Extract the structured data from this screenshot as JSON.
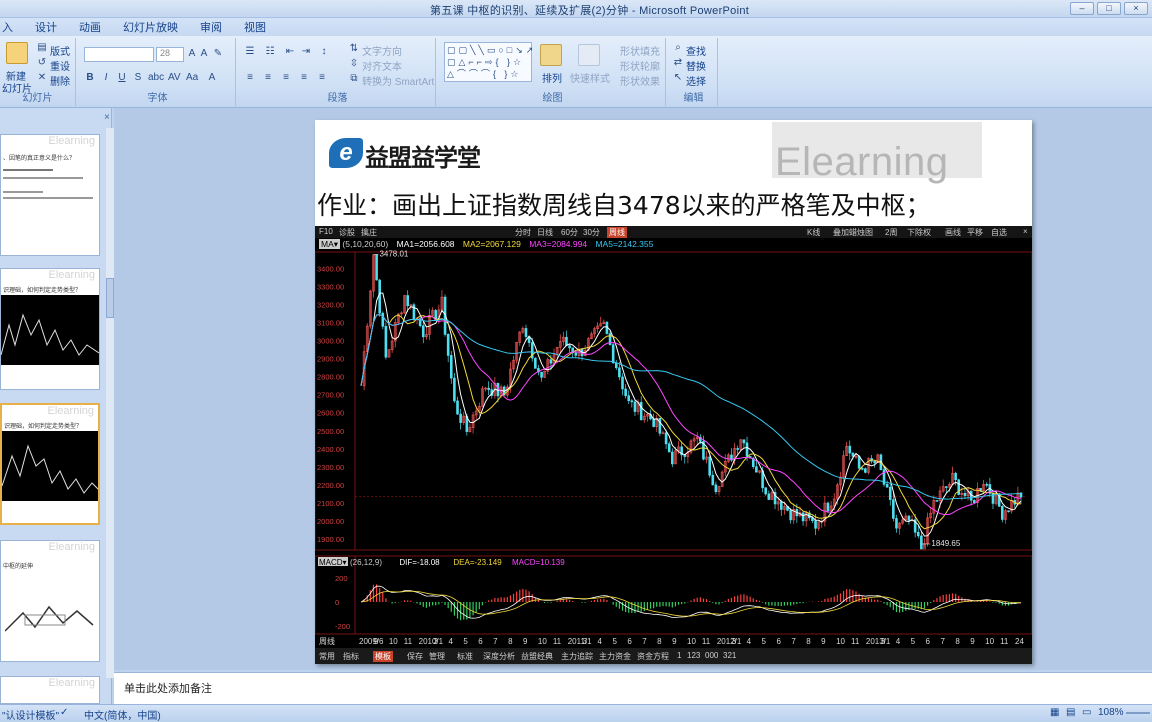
{
  "window": {
    "title": "第五课 中枢的识别、延续及扩展(2)分钟 - Microsoft PowerPoint"
  },
  "ribbon_tabs": [
    "入",
    "设计",
    "动画",
    "幻灯片放映",
    "审阅",
    "视图"
  ],
  "ribbon": {
    "slides_group": {
      "new_slide": "新建",
      "new_slide2": "幻灯片",
      "layout": "版式",
      "reset": "重设",
      "delete": "删除",
      "label": "幻灯片"
    },
    "font_group": {
      "font_size": "28",
      "label": "字体"
    },
    "paragraph_group": {
      "text_direction": "文字方向",
      "align_text": "对齐文本",
      "smartart": "转换为 SmartArt",
      "label": "段落"
    },
    "drawing_group": {
      "arrange": "排列",
      "quick_styles": "快速样式",
      "shape_fill": "形状填充",
      "shape_outline": "形状轮廓",
      "shape_effects": "形状效果",
      "label": "绘图"
    },
    "editing_group": {
      "find": "查找",
      "replace": "替换",
      "select": "选择",
      "label": "编辑"
    }
  },
  "thumbnails": [
    {
      "banner": "Elearning",
      "line1": "、因笔的真正意义是什么？",
      "line2": "",
      "line3": "",
      "line4": ""
    },
    {
      "banner": "Elearning",
      "line1": "识理础，如何判定走势类型？",
      "line2": "",
      "line3": "",
      "line4": ""
    },
    {
      "banner": "Elearning",
      "line1": "识理础，如何判定走势类型？",
      "line2": "",
      "line3": "",
      "line4": ""
    },
    {
      "banner": "Elearning",
      "line1": "中枢的延伸",
      "line2": "",
      "line3": "",
      "line4": ""
    },
    {
      "banner": "Elearning",
      "line1": "",
      "line2": "",
      "line3": "",
      "line4": ""
    }
  ],
  "slide": {
    "brand_watermark": "Elearning",
    "logo_name": "益盟益学堂",
    "logo_mark": "e",
    "homework": "作业：画出上证指数周线自3478以来的严格笔及中枢；"
  },
  "stock": {
    "toolbar": {
      "f10": "F10",
      "diag": "诊股",
      "tag": "擒庄",
      "fenshi": "分时",
      "day": "日线",
      "m60": "60分",
      "m30": "30分",
      "week": "周线",
      "kline": "K线",
      "overlay": "叠加蜡烛图",
      "period": "2周",
      "adjust": "下除权",
      "draw": "画线",
      "flat": "平移",
      "custom": "自选",
      "close": "×"
    },
    "ma_bar": {
      "ma": "MA▾",
      "params": "(5,10,20,60)",
      "ma1": "MA1=2056.608",
      "ma2": "MA2=2067.129",
      "ma3": "MA3=2084.994",
      "ma5": "MA5=2142.355",
      "colors": {
        "ma1": "#ffffff",
        "ma2": "#f3d93b",
        "ma3": "#ff46ff",
        "ma5": "#36c8f0"
      }
    },
    "price_labels": [
      "3400.00",
      "3300.00",
      "3200.00",
      "3100.00",
      "3000.00",
      "2900.00",
      "2800.00",
      "2700.00",
      "2600.00",
      "2500.00",
      "2400.00",
      "2300.00",
      "2200.00",
      "2100.00",
      "2000.00",
      "1900.00"
    ],
    "high_label": "3478.01",
    "low_label": "1849.65",
    "macd_bar": {
      "name": "MACD▾",
      "params": "(26,12,9)",
      "dif": "DIF=-18.08",
      "dea": "DEA=-23.149",
      "macd": "MACD=10.139"
    },
    "macd_ticks": [
      "200",
      "0",
      "-200"
    ],
    "date_labels": [
      "周线",
      "2009/6",
      "9",
      "10",
      "11",
      "2010/1",
      "3",
      "4",
      "5",
      "6",
      "7",
      "8",
      "9",
      "10",
      "11",
      "2011/1",
      "3",
      "4",
      "5",
      "6",
      "7",
      "8",
      "9",
      "10",
      "11",
      "2012/1",
      "3",
      "4",
      "5",
      "6",
      "7",
      "8",
      "9",
      "10",
      "11",
      "2013/1",
      "3",
      "4",
      "5",
      "6",
      "7",
      "8",
      "9",
      "10",
      "11",
      "24"
    ],
    "bottom_bar": [
      "常用",
      "指标",
      "模板",
      "保存",
      "管理",
      "标准",
      "深度分析",
      "益盟经典",
      "主力追踪",
      "主力资金",
      "资金方程",
      "1",
      "123",
      "000",
      "321"
    ]
  },
  "notes_placeholder": "单击此处添加备注",
  "status": {
    "theme": "\"认设计模板\"",
    "lang": "中文(简体，中国)",
    "zoom": "108%"
  }
}
